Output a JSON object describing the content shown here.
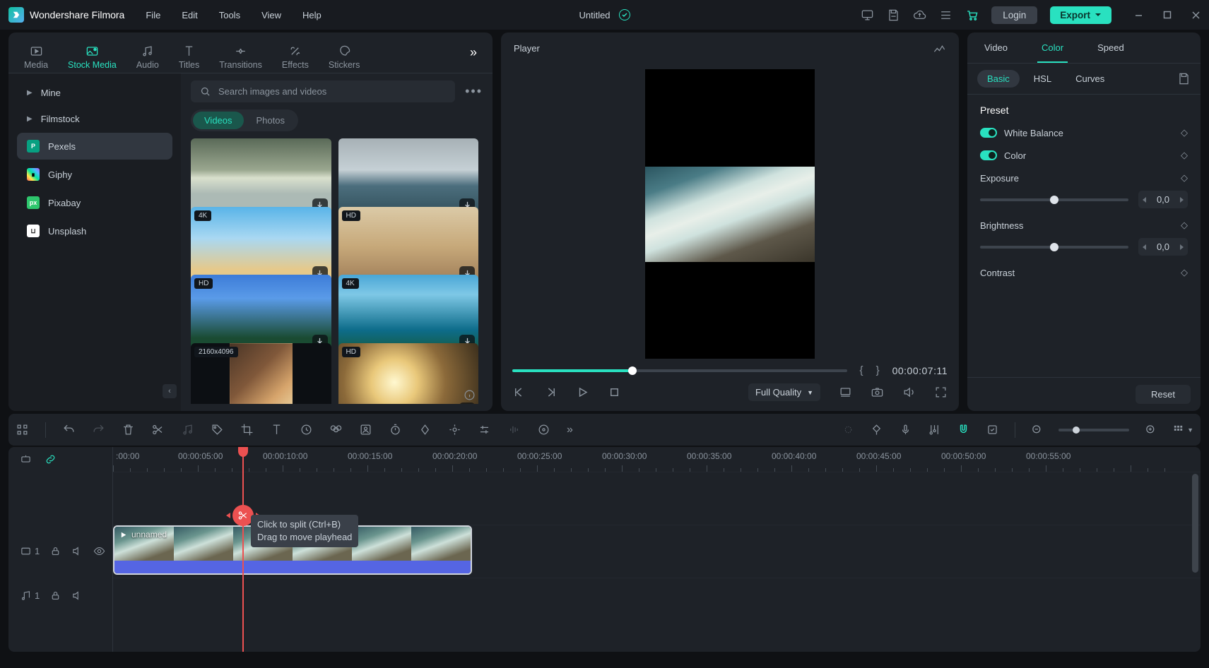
{
  "app": {
    "name": "Wondershare Filmora",
    "project_title": "Untitled"
  },
  "menu": [
    "File",
    "Edit",
    "Tools",
    "View",
    "Help"
  ],
  "title_actions": {
    "login": "Login",
    "export": "Export"
  },
  "media_tabs": [
    "Media",
    "Stock Media",
    "Audio",
    "Titles",
    "Transitions",
    "Effects",
    "Stickers"
  ],
  "media_tabs_active": "Stock Media",
  "sources": [
    {
      "label": "Mine",
      "kind": "caret"
    },
    {
      "label": "Filmstock",
      "kind": "caret"
    },
    {
      "label": "Pexels",
      "kind": "badge",
      "badge_bg": "#07a081",
      "badge_text": "P",
      "active": true
    },
    {
      "label": "Giphy",
      "kind": "badge",
      "badge_bg": "#000000",
      "badge_text": "G"
    },
    {
      "label": "Pixabay",
      "kind": "badge",
      "badge_bg": "#2ec66d",
      "badge_text": "px"
    },
    {
      "label": "Unsplash",
      "kind": "badge",
      "badge_bg": "#ffffff",
      "badge_text": ""
    }
  ],
  "search": {
    "placeholder": "Search images and videos"
  },
  "type_filter": {
    "options": [
      "Videos",
      "Photos"
    ],
    "active": "Videos"
  },
  "gallery": [
    {
      "badge": "",
      "bg": "g1"
    },
    {
      "badge": "",
      "bg": "g2"
    },
    {
      "badge": "4K",
      "bg": "g3"
    },
    {
      "badge": "HD",
      "bg": "g4"
    },
    {
      "badge": "HD",
      "bg": "g5"
    },
    {
      "badge": "4K",
      "bg": "g6"
    },
    {
      "badge": "2160x4096",
      "bg": "g7",
      "portrait": true
    },
    {
      "badge": "HD",
      "bg": "g8"
    }
  ],
  "player": {
    "title": "Player",
    "quality": "Full Quality",
    "timecode": "00:00:07:11"
  },
  "properties": {
    "tabs": [
      "Video",
      "Color",
      "Speed"
    ],
    "tabs_active": "Color",
    "subtabs": [
      "Basic",
      "HSL",
      "Curves"
    ],
    "subtabs_active": "Basic",
    "preset_title": "Preset",
    "groups": [
      {
        "label": "White Balance"
      },
      {
        "label": "Color"
      }
    ],
    "params": [
      {
        "label": "Exposure",
        "value": "0,0"
      },
      {
        "label": "Brightness",
        "value": "0,0"
      },
      {
        "label": "Contrast",
        "value": ""
      }
    ],
    "reset": "Reset"
  },
  "timeline": {
    "marks": [
      "00:00",
      "00:00:05:00",
      "00:00:10:00",
      "00:00:15:00",
      "00:00:20:00",
      "00:00:25:00",
      "00:00:30:00",
      "00:00:35:00",
      "00:00:40:00",
      "00:00:45:00",
      "00:00:50:00",
      "00:00:55:00"
    ],
    "mark_spacing_px": 120,
    "video_track_index": "1",
    "audio_track_index": "1",
    "clip_name": "unnamed",
    "tooltip_line1": "Click to split (Ctrl+B)",
    "tooltip_line2": "Drag to move playhead"
  }
}
